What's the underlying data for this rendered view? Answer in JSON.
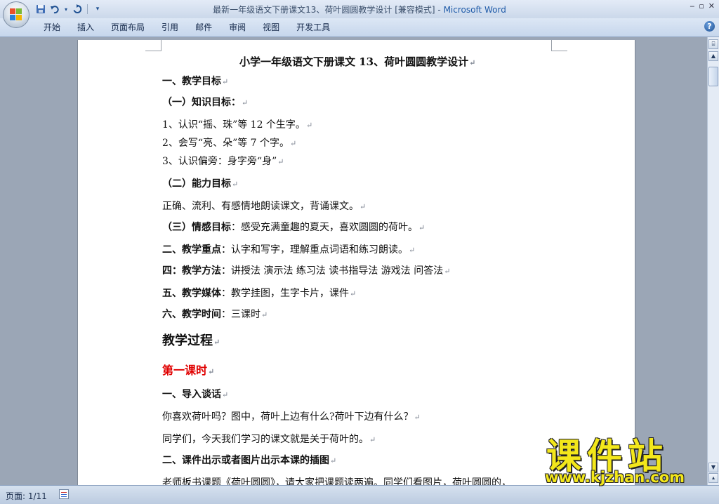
{
  "window": {
    "doc_title": "最新一年级语文下册课文13、荷叶圆圆教学设计 [兼容模式]",
    "separator": " - ",
    "app_name": "Microsoft Word"
  },
  "ribbon": {
    "tabs": [
      "开始",
      "插入",
      "页面布局",
      "引用",
      "邮件",
      "审阅",
      "视图",
      "开发工具"
    ]
  },
  "document": {
    "mark": "↵",
    "title": "小学一年级语文下册课文 13、荷叶圆圆教学设计",
    "goals_heading": "一、教学目标",
    "knowledge_heading": "（一）知识目标：",
    "k1": "1、认识“摇、珠”等 12 个生字。",
    "k2": "2、会写“亮、朵”等 7 个字。",
    "k3": "3、认识偏旁：身字旁“身”",
    "ability_heading": "（二）能力目标",
    "ability_text": " 正确、流利、有感情地朗读课文，背诵课文。",
    "emotion_heading": "（三）情感目标",
    "emotion_text": "：感受充满童趣的夏天，喜欢圆圆的荷叶。",
    "focus_heading": "二、教学重点",
    "focus_text": "：认字和写字，理解重点词语和练习朗读。",
    "method_heading": "四：教学方法",
    "method_text": "：讲授法 演示法  练习法  读书指导法  游戏法  问答法",
    "media_heading": "五、教学媒体",
    "media_text": "：教学挂图，生字卡片，课件",
    "time_heading": "六、教学时间",
    "time_text": "：三课时",
    "process_heading": "教学过程",
    "lesson1": "第一课时",
    "intro_heading": "一、导入谈话",
    "intro_q": "你喜欢荷叶吗？图中，荷叶上边有什么?荷叶下边有什么？",
    "intro_s": "同学们，今天我们学习的课文就是关于荷叶的。",
    "show_heading": "二、课件出示或者图片出示本课的插图",
    "last_line": "老师板书课题《荷叶圆圆》，请大家把课题读两遍。同学们看图片，荷叶圆圆的，"
  },
  "statusbar": {
    "page_info": "页面: 1/11"
  },
  "watermark": {
    "cn": "课件站",
    "url": "www.kjzhan.com"
  },
  "icons": [
    "office-button-icon",
    "save-icon",
    "undo-icon",
    "redo-icon",
    "customize-qat-icon",
    "help-icon",
    "minimize-icon",
    "maximize-icon",
    "scroll-up-icon",
    "ruler-icon",
    "scroll-down-icon",
    "document-status-icon"
  ]
}
